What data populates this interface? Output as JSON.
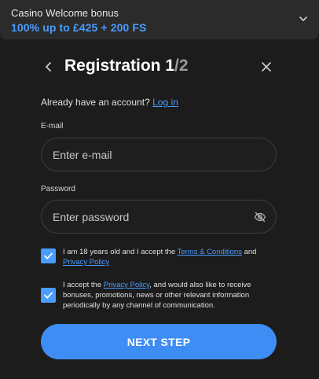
{
  "bonus": {
    "title": "Casino Welcome bonus",
    "offer": "100% up to £425 + 200 FS"
  },
  "header": {
    "title": "Registration 1",
    "step_total": "/2"
  },
  "account": {
    "prompt": "Already have an account?",
    "login_label": "Log in"
  },
  "form": {
    "email_label": "E-mail",
    "email_placeholder": "Enter e-mail",
    "email_value": "",
    "password_label": "Password",
    "password_placeholder": "Enter password",
    "password_value": ""
  },
  "consents": {
    "age": {
      "checked": true,
      "text_before": "I am 18 years old and I accept the ",
      "terms_link": "Terms & Conditions",
      "text_middle": " and ",
      "privacy_link": "Privacy Policy"
    },
    "marketing": {
      "checked": true,
      "text_before": "I accept the ",
      "privacy_link": "Privacy Policy",
      "text_after": ", and would also like to receive bonuses, promotions, news or other relevant information periodically by any channel of communication."
    }
  },
  "actions": {
    "next_label": "NEXT STEP"
  },
  "colors": {
    "accent": "#4a9cff",
    "button": "#3d8df5",
    "background": "#1c1c1c",
    "banner": "#2b2b2b"
  }
}
